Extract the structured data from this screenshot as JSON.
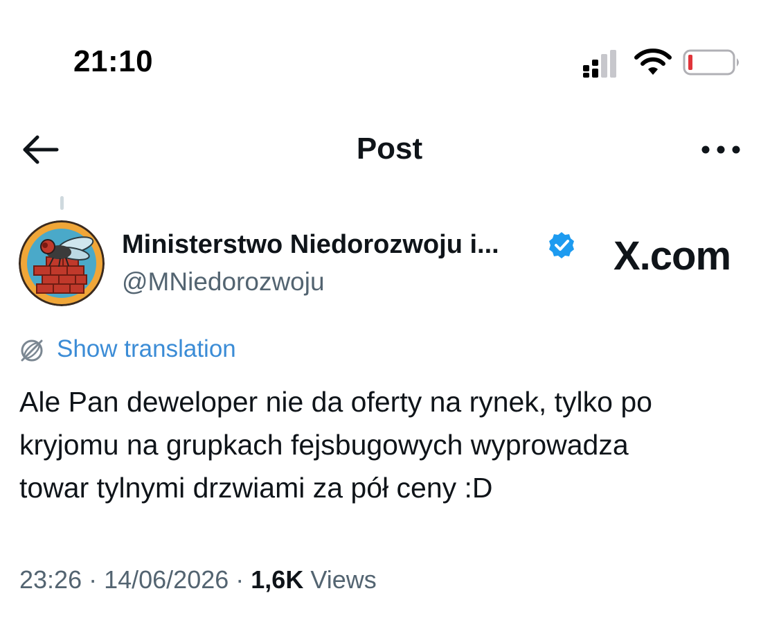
{
  "status_bar": {
    "time": "21:10",
    "icons": [
      "cellular-signal-icon",
      "wifi-icon",
      "battery-low-icon"
    ],
    "battery_color": "#e0343a"
  },
  "header": {
    "title": "Post",
    "back_icon": "arrow-left-icon",
    "more_icon": "more-horizontal-icon"
  },
  "post": {
    "author": {
      "display_name": "Ministerstwo Niedorozwoju i...",
      "handle": "@MNiedorozwoju",
      "verified": true,
      "verified_color": "#1d9bf0",
      "avatar_icon": "fly-on-bricks-avatar"
    },
    "watermark": "X.com",
    "translation": {
      "label": "Show translation",
      "icon": "translate-globe-icon",
      "color": "#3b8cd6"
    },
    "text_lines": [
      "Ale Pan deweloper nie da oferty na rynek, tylko po",
      "kryjomu na grupkach fejsbugowych wyprowadza",
      "towar tylnymi drzwiami za pół ceny :D"
    ],
    "meta": {
      "time": "23:26",
      "separator": " · ",
      "date": "14/06/2026",
      "views_count": "1,6K",
      "views_label": "Views"
    }
  }
}
